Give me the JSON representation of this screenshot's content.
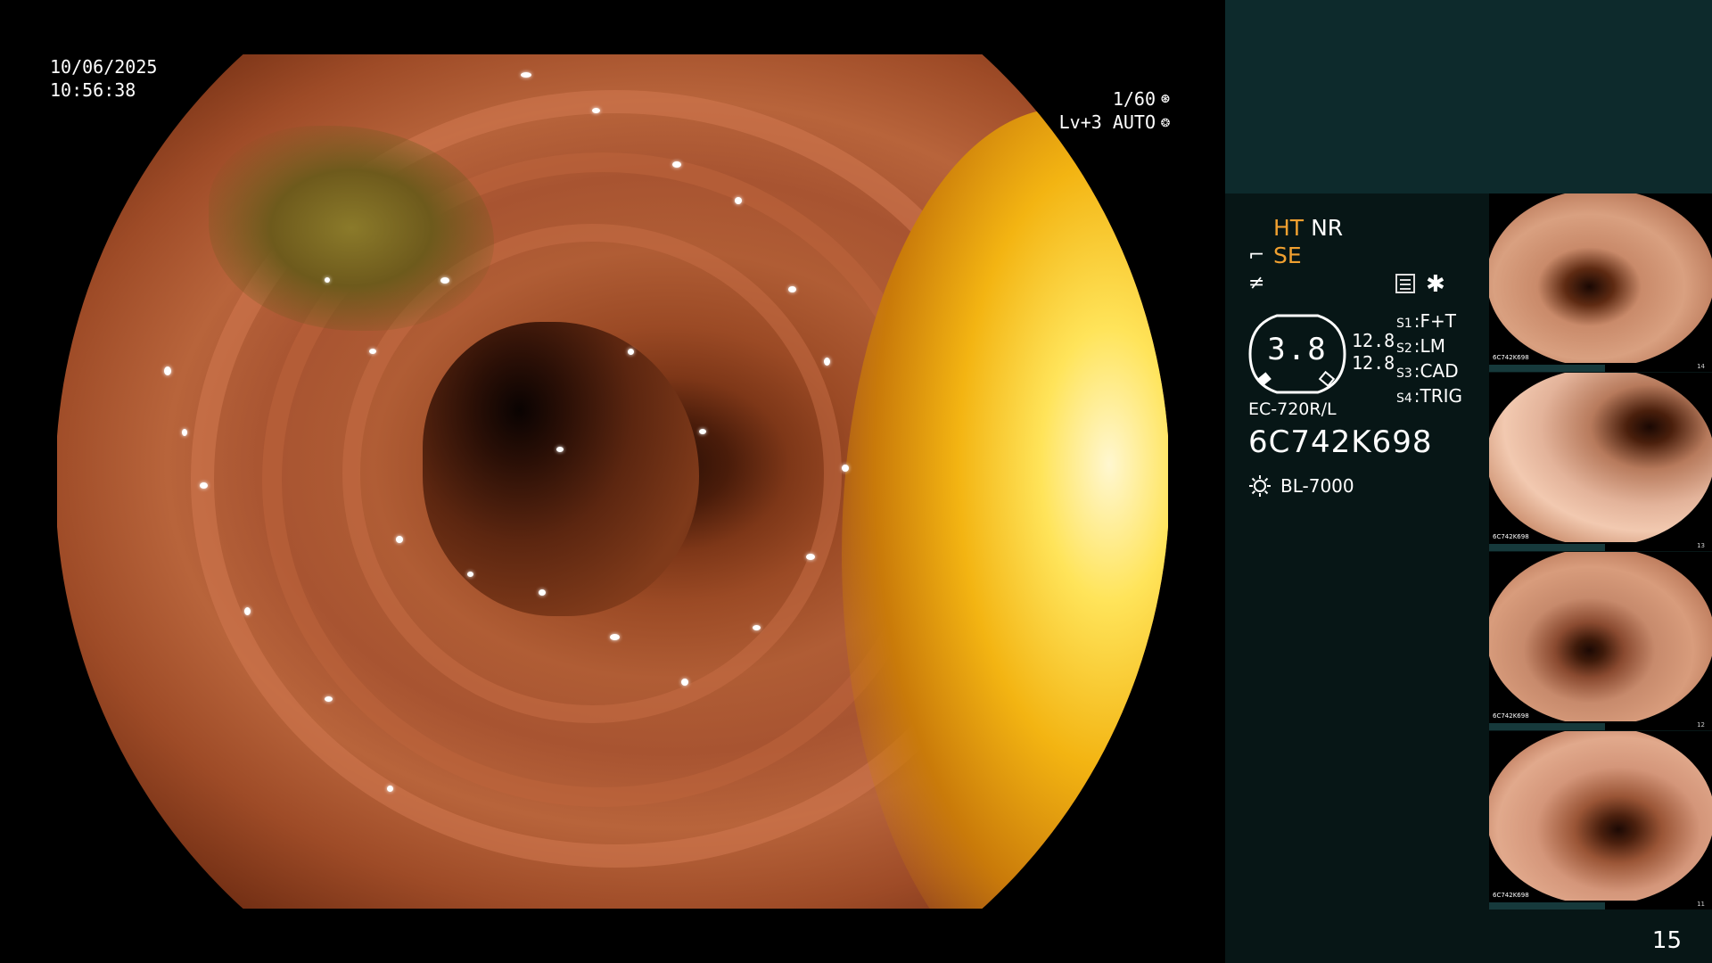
{
  "osd": {
    "date": "10/06/2025",
    "time": "10:56:38",
    "shutter": "1/60",
    "shutter_icon": "aperture-icon",
    "level": "Lv+3 AUTO",
    "level_icon": "iris-icon"
  },
  "panel": {
    "modes": {
      "ht": "HT",
      "nr": "NR",
      "se": "SE",
      "colors": {
        "active": "#f0a030",
        "inactive": "#ffffff"
      }
    },
    "gauge": {
      "value": "3.8",
      "side_top": "12.8",
      "side_bottom": "12.8"
    },
    "switches": [
      {
        "key": "S1",
        "value": "F+T"
      },
      {
        "key": "S2",
        "value": "LM"
      },
      {
        "key": "S3",
        "value": "CAD"
      },
      {
        "key": "S4",
        "value": "TRIG"
      }
    ],
    "scope_model": "EC-720R/L",
    "serial": "6C742K698",
    "light_source": "BL-7000",
    "page_number": "15"
  },
  "thumbnails": [
    {
      "label": "6C742K698",
      "index": "14"
    },
    {
      "label": "6C742K698",
      "index": "13"
    },
    {
      "label": "6C742K698",
      "index": "12"
    },
    {
      "label": "6C742K698",
      "index": "11"
    }
  ]
}
